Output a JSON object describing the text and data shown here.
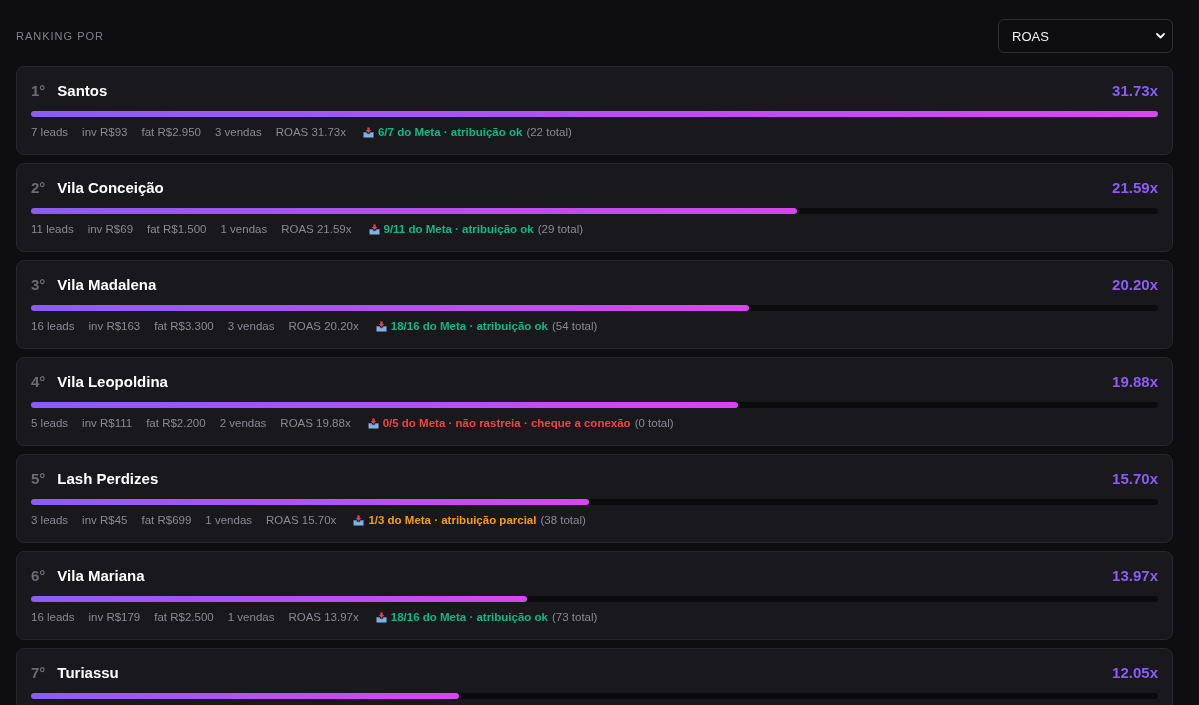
{
  "ranking_by": {
    "label": "RANKING POR",
    "select": {
      "value": "ROAS"
    }
  },
  "ranking": [
    {
      "rank": "1°",
      "name": "Santos",
      "value": "31.73x",
      "level": 1.0,
      "stats": [
        "7 leads",
        "inv R$93",
        "fat R$2.950",
        "3 vendas",
        "ROAS 31.73x"
      ],
      "attribution": {
        "status": "6/7 do Meta · atribuição ok",
        "color": "#10b981",
        "total": "(22 total)"
      }
    },
    {
      "rank": "2°",
      "name": "Vila Conceição",
      "value": "21.59x",
      "level": 0.68,
      "stats": [
        "11 leads",
        "inv R$69",
        "fat R$1.500",
        "1 vendas",
        "ROAS 21.59x"
      ],
      "attribution": {
        "status": "9/11 do Meta · atribuição ok",
        "color": "#10b981",
        "total": "(29 total)"
      }
    },
    {
      "rank": "3°",
      "name": "Vila Madalena",
      "value": "20.20x",
      "level": 0.637,
      "stats": [
        "16 leads",
        "inv R$163",
        "fat R$3.300",
        "3 vendas",
        "ROAS 20.20x"
      ],
      "attribution": {
        "status": "18/16 do Meta · atribuição ok",
        "color": "#10b981",
        "total": "(54 total)"
      }
    },
    {
      "rank": "4°",
      "name": "Vila Leopoldina",
      "value": "19.88x",
      "level": 0.627,
      "stats": [
        "5 leads",
        "inv R$111",
        "fat R$2.200",
        "2 vendas",
        "ROAS 19.88x"
      ],
      "attribution": {
        "status": "0/5 do Meta · não rastreia · cheque a conexão",
        "color": "#ef4444",
        "total": "(0 total)"
      }
    },
    {
      "rank": "5°",
      "name": "Lash Perdizes",
      "value": "15.70x",
      "level": 0.495,
      "stats": [
        "3 leads",
        "inv R$45",
        "fat R$699",
        "1 vendas",
        "ROAS 15.70x"
      ],
      "attribution": {
        "status": "1/3 do Meta · atribuição parcial",
        "color": "#f59e0b",
        "total": "(38 total)"
      }
    },
    {
      "rank": "6°",
      "name": "Vila Mariana",
      "value": "13.97x",
      "level": 0.44,
      "stats": [
        "16 leads",
        "inv R$179",
        "fat R$2.500",
        "1 vendas",
        "ROAS 13.97x"
      ],
      "attribution": {
        "status": "18/16 do Meta · atribuição ok",
        "color": "#10b981",
        "total": "(73 total)"
      }
    },
    {
      "rank": "7°",
      "name": "Turiassu",
      "value": "12.05x",
      "level": 0.38
    }
  ]
}
